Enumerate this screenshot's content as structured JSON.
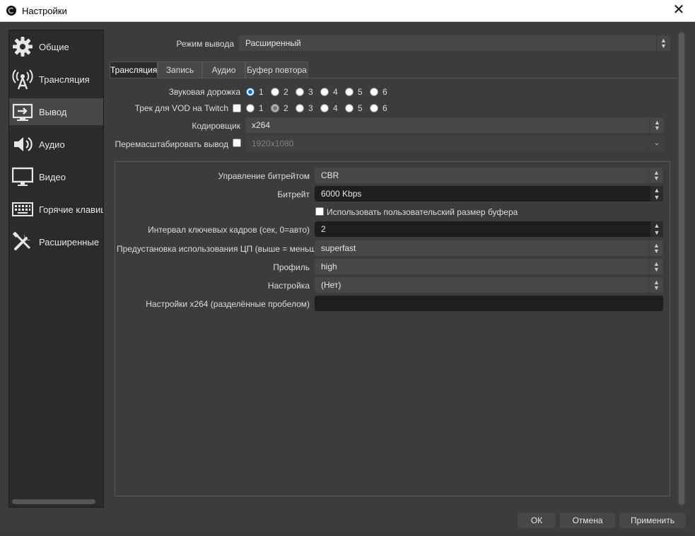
{
  "window": {
    "title": "Настройки",
    "close_glyph": "✕"
  },
  "sidebar": {
    "items": [
      {
        "label": "Общие",
        "icon": "gear-icon"
      },
      {
        "label": "Трансляция",
        "icon": "broadcast-icon"
      },
      {
        "label": "Вывод",
        "icon": "output-icon"
      },
      {
        "label": "Аудио",
        "icon": "speaker-icon"
      },
      {
        "label": "Видео",
        "icon": "monitor-icon"
      },
      {
        "label": "Горячие клавиш",
        "icon": "keyboard-icon"
      },
      {
        "label": "Расширенные",
        "icon": "tools-icon"
      }
    ],
    "active_index": 2
  },
  "output_mode": {
    "label": "Режим вывода",
    "value": "Расширенный"
  },
  "tabs": [
    {
      "label": "Трансляция",
      "active": true
    },
    {
      "label": "Запись",
      "active": false
    },
    {
      "label": "Аудио",
      "active": false
    },
    {
      "label": "Буфер повтора",
      "active": false
    }
  ],
  "audio_track": {
    "label": "Звуковая дорожка",
    "options": [
      "1",
      "2",
      "3",
      "4",
      "5",
      "6"
    ],
    "selected": "1"
  },
  "vod_track": {
    "label": "Трек для VOD на Twitch",
    "checked": false,
    "options": [
      "1",
      "2",
      "3",
      "4",
      "5",
      "6"
    ],
    "selected": "2"
  },
  "encoder": {
    "label": "Кодировщик",
    "value": "x264"
  },
  "rescale": {
    "label": "Перемасштабировать вывод",
    "checked": false,
    "value": "1920x1080"
  },
  "encoder_settings": {
    "rate_control": {
      "label": "Управление битрейтом",
      "value": "CBR"
    },
    "bitrate": {
      "label": "Битрейт",
      "value": "6000 Kbps"
    },
    "custom_buffer": {
      "label": "Использовать пользовательский размер буфера",
      "checked": false
    },
    "keyframe_interval": {
      "label": "Интервал ключевых кадров (сек, 0=авто)",
      "value": "2"
    },
    "cpu_preset": {
      "label": "Предустановка использования ЦП (выше = меньше)",
      "value": "superfast"
    },
    "profile": {
      "label": "Профиль",
      "value": "high"
    },
    "tune": {
      "label": "Настройка",
      "value": "(Нет)"
    },
    "x264_options": {
      "label": "Настройки x264 (разделённые пробелом)",
      "value": ""
    }
  },
  "buttons": {
    "ok": "ОК",
    "cancel": "Отмена",
    "apply": "Применить"
  }
}
